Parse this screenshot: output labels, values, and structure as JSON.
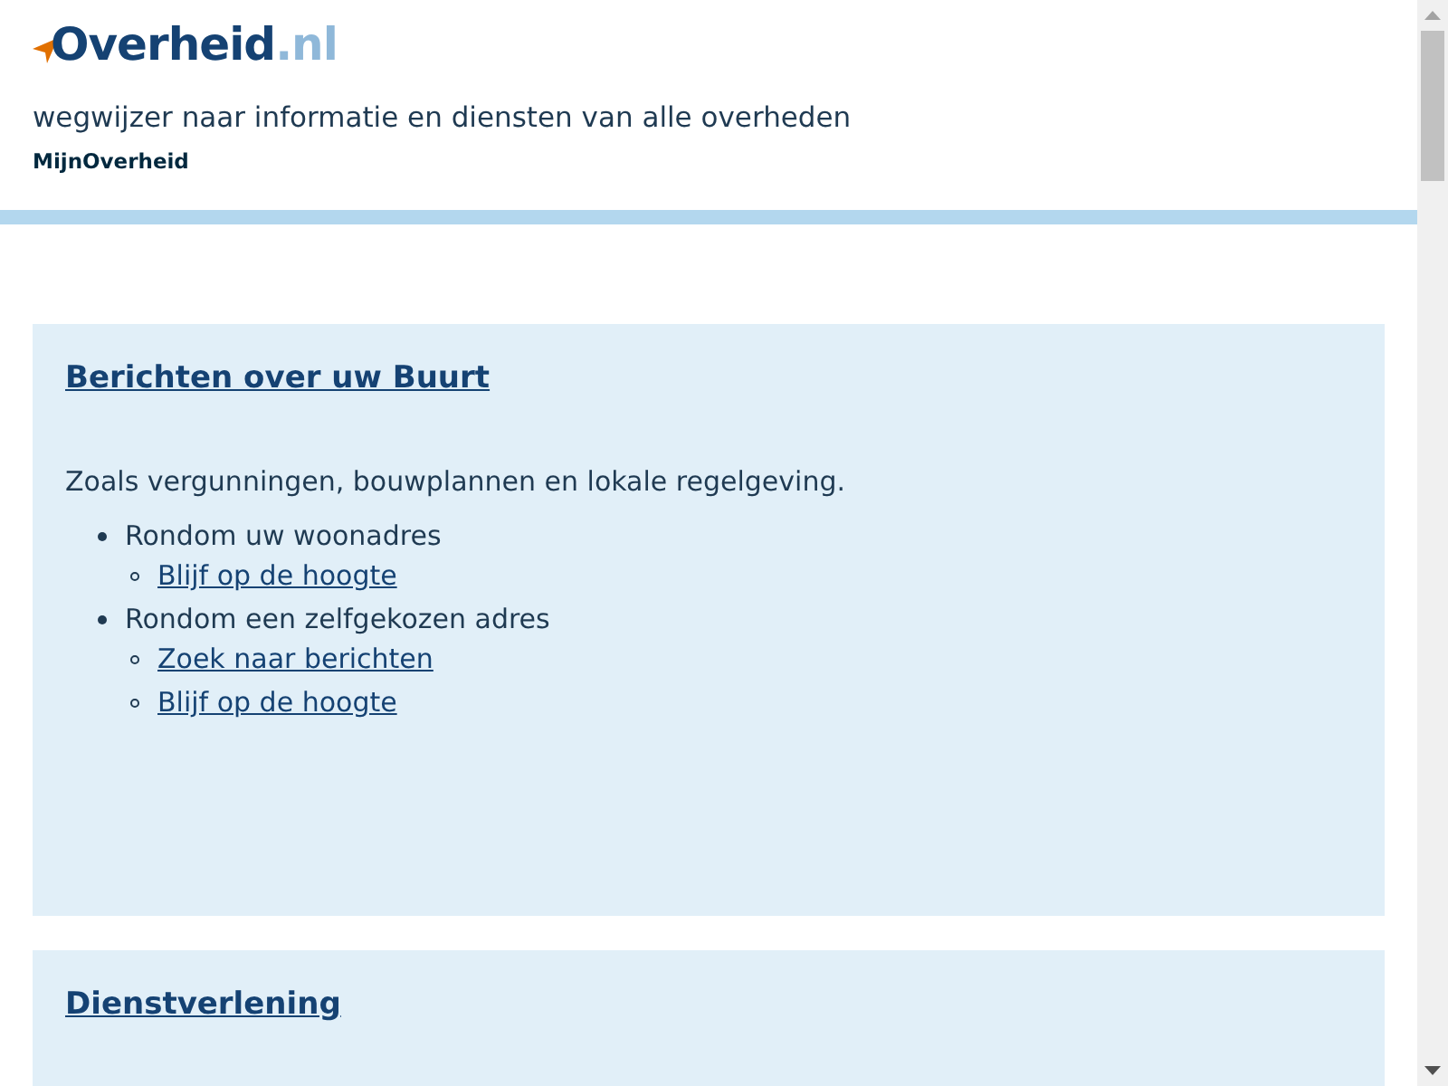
{
  "header": {
    "logo": "Overheid",
    "logo_suffix": ".nl",
    "tagline": "wegwijzer naar informatie en diensten van alle overheden",
    "account_link": "MijnOverheid"
  },
  "cards": [
    {
      "title": "Berichten over uw Buurt",
      "intro": "Zoals vergunningen, bouwplannen en lokale regelgeving.",
      "items": [
        {
          "label": "Rondom uw woonadres",
          "links": [
            "Blijf op de hoogte"
          ]
        },
        {
          "label": "Rondom een zelfgekozen adres",
          "links": [
            "Zoek naar berichten",
            "Blijf op de hoogte"
          ]
        }
      ]
    },
    {
      "title": "Dienstverlening"
    }
  ]
}
